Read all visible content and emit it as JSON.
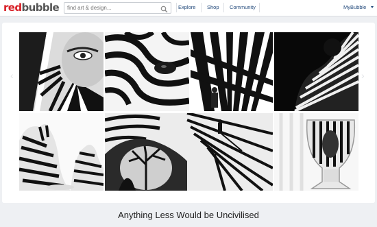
{
  "header": {
    "logo_red": "red",
    "logo_grey": "bubble",
    "search_placeholder": "find art & design...",
    "nav": [
      "Explore",
      "Shop",
      "Community"
    ],
    "account_label": "MyBubble"
  },
  "gallery": {
    "tiles": [
      {
        "subject": "face with black and white stripes"
      },
      {
        "subject": "zebra eye close-up"
      },
      {
        "subject": "figure in striped room"
      },
      {
        "subject": "striped silhouette"
      },
      {
        "subject": "zebra herd"
      },
      {
        "subject": "tree silhouette with striped sky"
      },
      {
        "subject": "striped glass"
      }
    ]
  },
  "page": {
    "title": "Anything Less Would be Uncivilised"
  },
  "colors": {
    "brand_red": "#d81f26",
    "link_blue": "#21487a"
  },
  "icons": [
    "search-icon",
    "chevron-down-icon",
    "arrow-left-icon",
    "arrow-right-icon"
  ]
}
